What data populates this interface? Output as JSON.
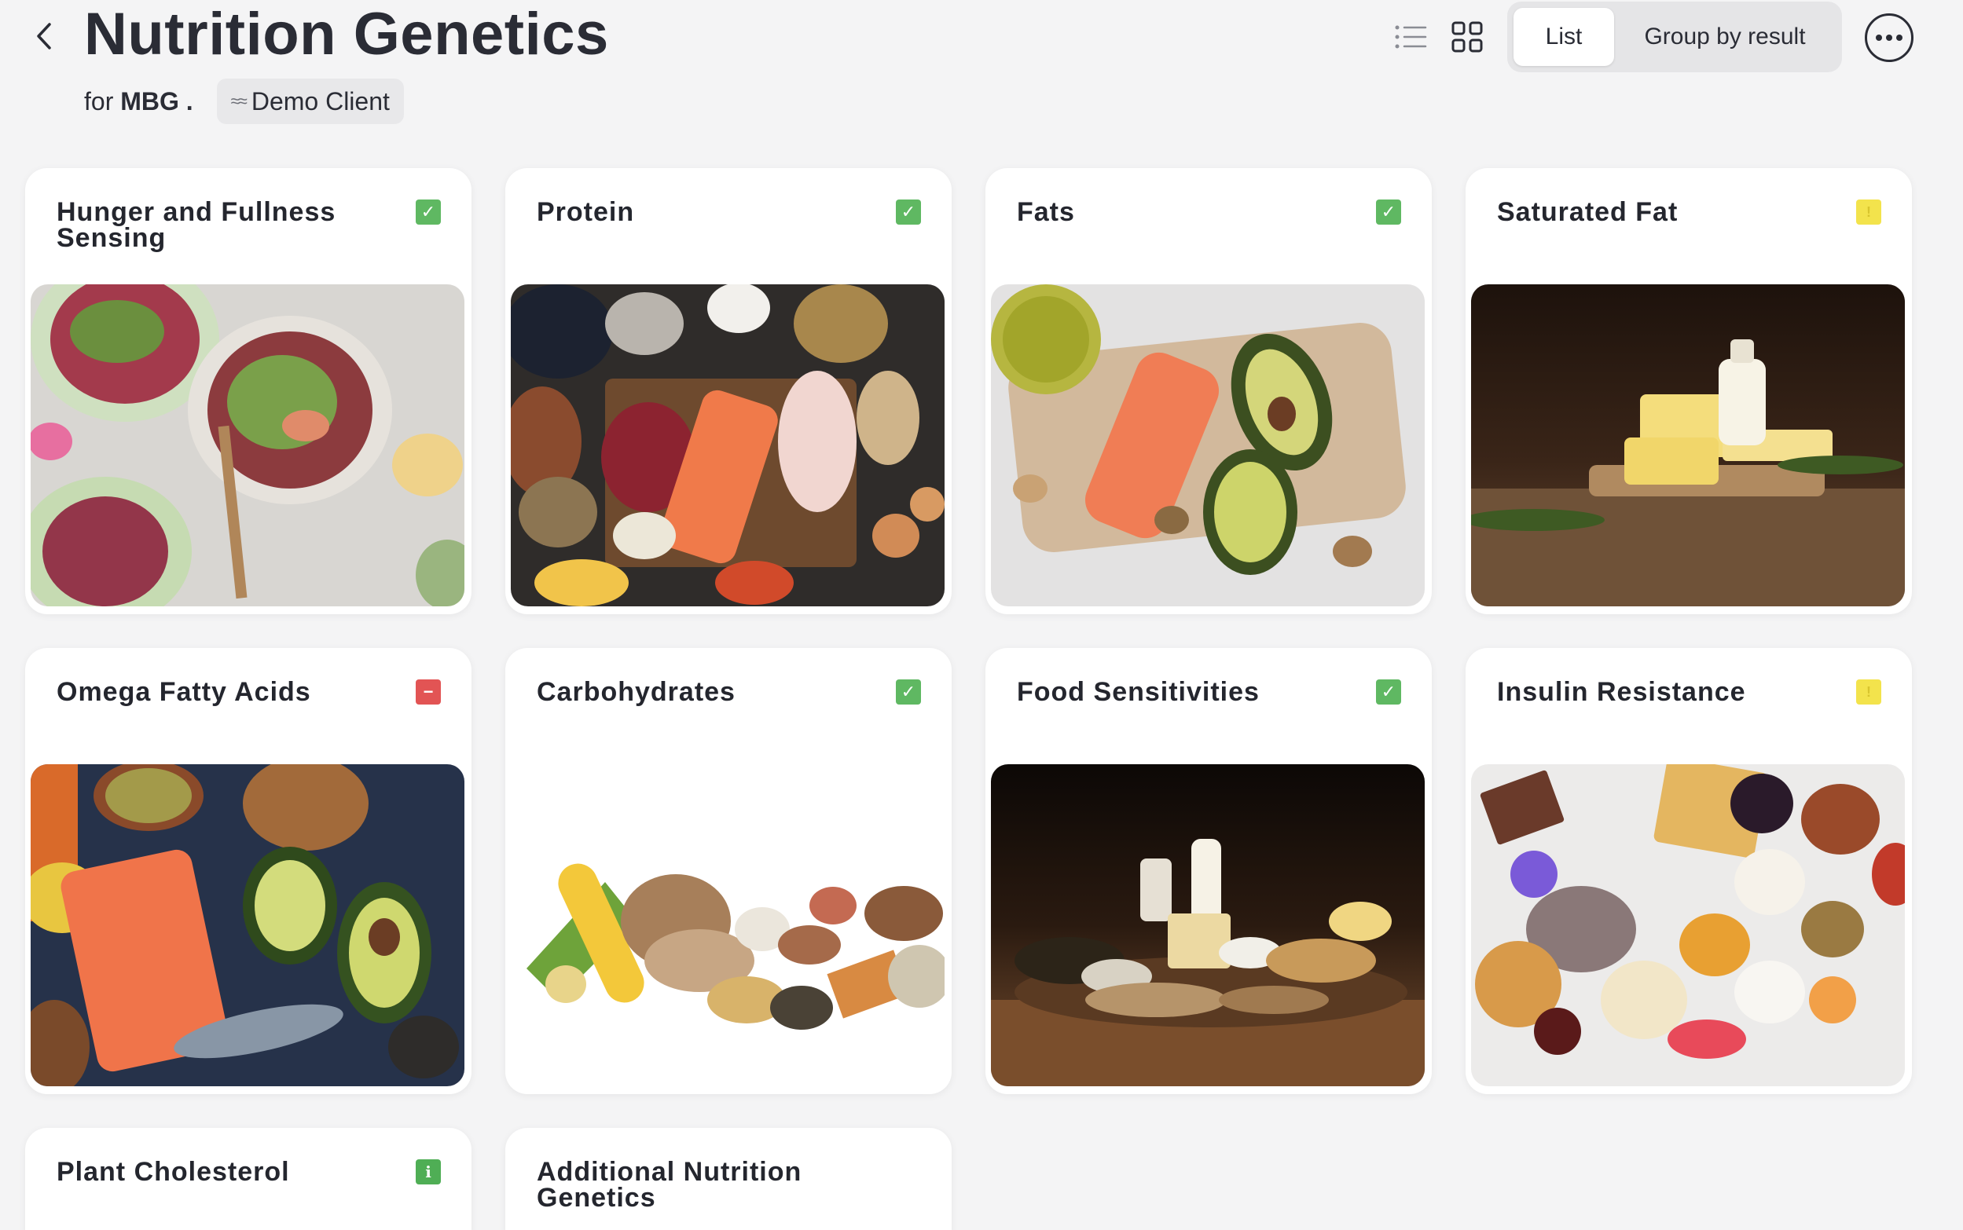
{
  "header": {
    "title": "Nutrition Genetics",
    "for_prefix": "for",
    "for_name": "MBG .",
    "client_chip": "Demo Client",
    "view_toggle": {
      "list_label": "List",
      "group_label": "Group by result",
      "active": "List"
    }
  },
  "cards": [
    {
      "title": "Hunger and Fullness Sensing",
      "status": "check"
    },
    {
      "title": "Protein",
      "status": "check"
    },
    {
      "title": "Fats",
      "status": "check"
    },
    {
      "title": "Saturated Fat",
      "status": "warn"
    },
    {
      "title": "Omega Fatty Acids",
      "status": "minus"
    },
    {
      "title": "Carbohydrates",
      "status": "check"
    },
    {
      "title": "Food Sensitivities",
      "status": "check"
    },
    {
      "title": "Insulin Resistance",
      "status": "warn"
    },
    {
      "title": "Plant Cholesterol",
      "status": "info"
    },
    {
      "title": "Additional Nutrition Genetics",
      "status": "none"
    }
  ],
  "badge_symbols": {
    "check": "✓",
    "minus": "−",
    "warn": "!",
    "info": "i"
  },
  "colors": {
    "status_check": "#5fb862",
    "status_minus": "#e25454",
    "status_warn": "#f3e34c",
    "status_info": "#4fae55",
    "background": "#f4f4f5"
  },
  "icons": [
    "back-chevron-icon",
    "list-view-icon",
    "grid-view-icon",
    "more-options-icon",
    "client-wave-icon"
  ]
}
